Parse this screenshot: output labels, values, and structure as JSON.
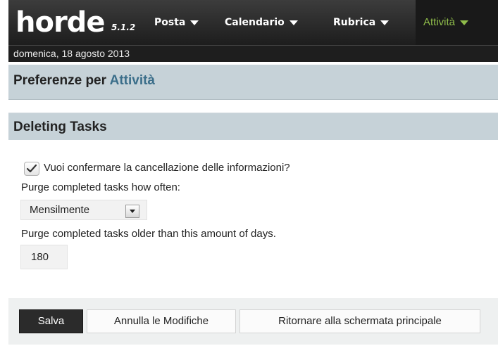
{
  "app": {
    "name": "horde",
    "version": "5.1.2"
  },
  "menu": {
    "items": [
      {
        "label": "Posta"
      },
      {
        "label": "Calendario"
      },
      {
        "label": "Rubrica"
      },
      {
        "label": "Attività"
      }
    ],
    "active_color": "#8fbc4a"
  },
  "date": "domenica, 18 agosto 2013",
  "prefs": {
    "title_prefix": "Preferenze per",
    "app_name": "Attività"
  },
  "section": {
    "title": "Deleting Tasks"
  },
  "form": {
    "confirm_delete": {
      "label": "Vuoi confermare la cancellazione delle informazioni?",
      "checked": true
    },
    "purge_often": {
      "label": "Purge completed tasks how often:",
      "selected": "Mensilmente"
    },
    "purge_days": {
      "label": "Purge completed tasks older than this amount of days.",
      "value": "180"
    }
  },
  "buttons": {
    "save": "Salva",
    "undo": "Annulla le Modifiche",
    "return": "Ritornare alla schermata principale"
  }
}
